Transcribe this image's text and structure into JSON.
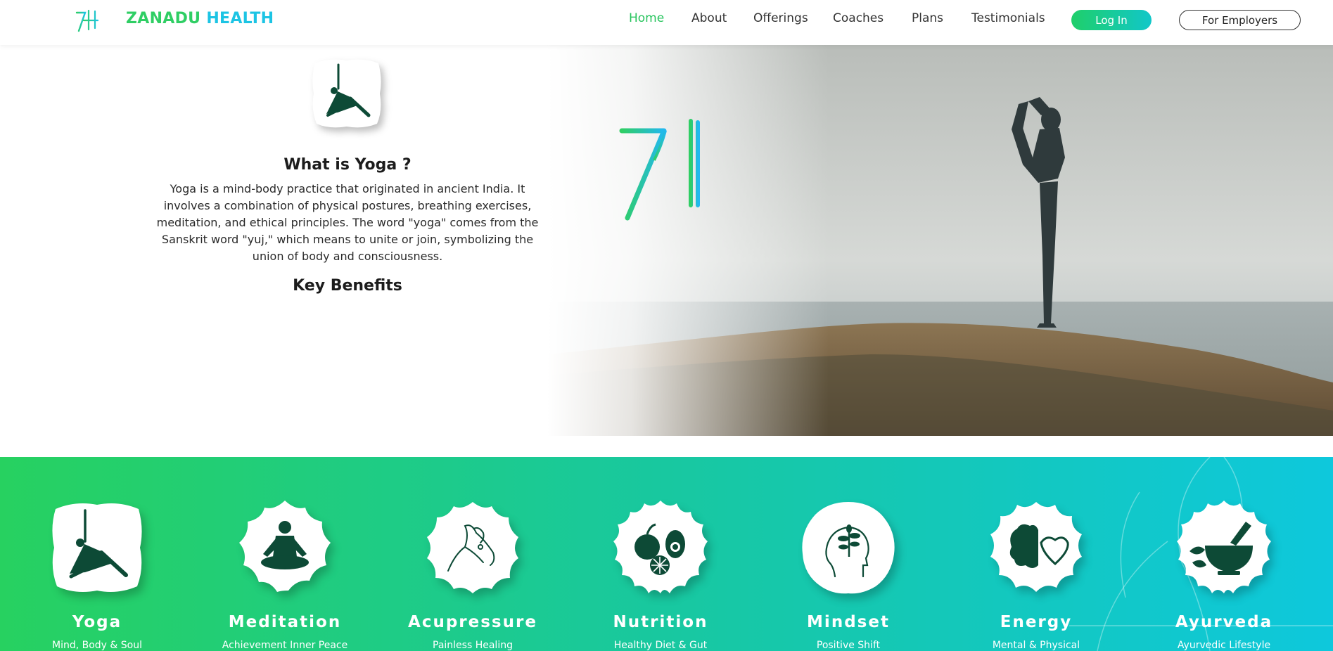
{
  "header": {
    "brand_part1": "ZANADU",
    "brand_part2": "HEALTH",
    "nav": [
      "Home",
      "About",
      "Offerings",
      "Coaches",
      "Plans",
      "Testimonials"
    ],
    "active_nav": "Home",
    "login_label": "Log In",
    "employers_label": "For Employers"
  },
  "hero": {
    "title": "What is Yoga ?",
    "description": "Yoga is a mind-body practice that originated in ancient India. It involves a combination of physical postures, breathing exercises, meditation, and ethical principles. The word \"yoga\" comes from the Sanskrit word \"yuj,\" which means to unite or join, symbolizing the union of body and consciousness.",
    "key_benefits_title": "Key Benefits",
    "badge_icon": "triangle-pose-icon"
  },
  "offerings": [
    {
      "name": "Yoga",
      "subtitle": "Mind, Body & Soul",
      "icon": "triangle-pose-icon"
    },
    {
      "name": "Meditation",
      "subtitle": "Achievement Inner Peace",
      "icon": "meditation-icon"
    },
    {
      "name": "Acupressure",
      "subtitle": "Painless Healing",
      "icon": "acupressure-hand-icon"
    },
    {
      "name": "Nutrition",
      "subtitle": "Healthy Diet & Gut",
      "icon": "fruits-icon"
    },
    {
      "name": "Mindset",
      "subtitle": "Positive Shift",
      "icon": "growth-mind-icon"
    },
    {
      "name": "Energy",
      "subtitle": "Mental & Physical",
      "icon": "brain-heart-icon"
    },
    {
      "name": "Ayurveda",
      "subtitle": "Ayurvedic Lifestyle",
      "icon": "mortar-pestle-icon"
    }
  ],
  "colors": {
    "brand_green": "#2fce64",
    "brand_blue": "#1cc4e4",
    "icon_dark_green": "#0d4a36",
    "band_gradient_start": "#27d160",
    "band_gradient_end": "#0ec8dc"
  }
}
